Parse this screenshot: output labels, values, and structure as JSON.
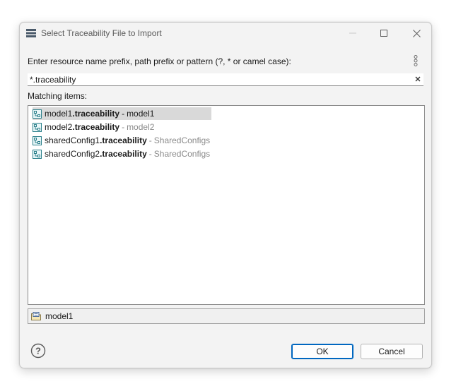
{
  "window": {
    "title": "Select Traceability File to Import"
  },
  "prompt": "Enter resource name prefix, path prefix or pattern (?, * or camel case):",
  "search": {
    "value": "*.traceability"
  },
  "matching_label": "Matching items:",
  "items": [
    {
      "prefix": "model1",
      "match": ".traceability",
      "folder": "model1",
      "selected": true
    },
    {
      "prefix": "model2",
      "match": ".traceability",
      "folder": "model2",
      "selected": false
    },
    {
      "prefix": "sharedConfig1",
      "match": ".traceability",
      "folder": "SharedConfigs",
      "selected": false
    },
    {
      "prefix": "sharedConfig2",
      "match": ".traceability",
      "folder": "SharedConfigs",
      "selected": false
    }
  ],
  "separator": "-",
  "details": {
    "text": "model1"
  },
  "buttons": {
    "ok": "OK",
    "cancel": "Cancel"
  },
  "colors": {
    "accent": "#0067c0",
    "selection": "#d9d9d9",
    "folder_text": "#8a8a8a",
    "file_icon": "#2a7f8a"
  },
  "icons": {
    "title": "dialog-list-icon",
    "menu": "kebab-menu-icon",
    "clear": "clear-x-icon",
    "file": "traceability-file-icon",
    "details": "project-folder-icon",
    "help": "help-icon"
  }
}
